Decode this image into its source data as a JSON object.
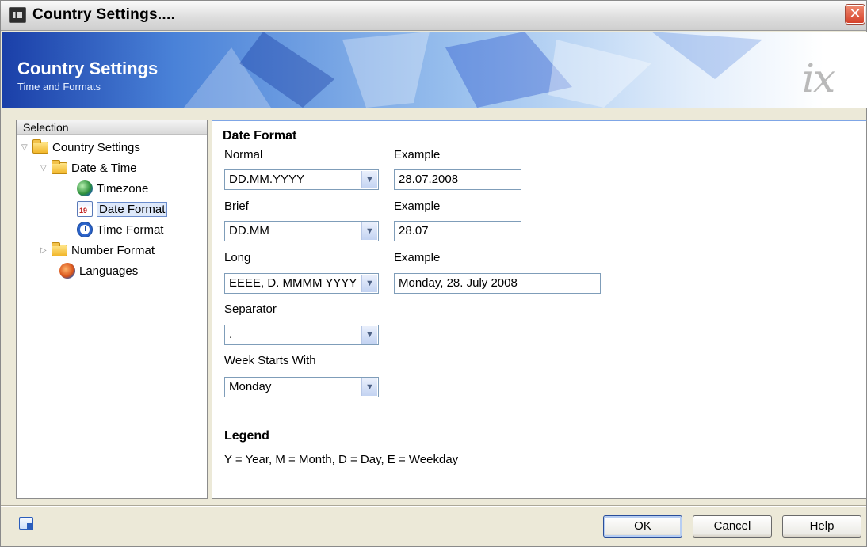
{
  "window": {
    "title": "Country Settings....",
    "close_label": "✕"
  },
  "banner": {
    "title": "Country Settings",
    "subtitle": "Time and Formats",
    "logo": "ix"
  },
  "tree": {
    "header": "Selection",
    "items": [
      {
        "label": "Country Settings",
        "icon": "folder-icon",
        "expanded": true
      },
      {
        "label": "Date & Time",
        "icon": "folder-icon",
        "expanded": true
      },
      {
        "label": "Timezone",
        "icon": "globe-icon"
      },
      {
        "label": "Date Format",
        "icon": "calendar-icon",
        "selected": true
      },
      {
        "label": "Time Format",
        "icon": "clock-icon"
      },
      {
        "label": "Number Format",
        "icon": "folder-icon",
        "expanded": false
      },
      {
        "label": "Languages",
        "icon": "languages-icon"
      }
    ]
  },
  "form": {
    "section_title": "Date Format",
    "normal": {
      "label": "Normal",
      "value": "DD.MM.YYYY",
      "example_label": "Example",
      "example": "28.07.2008"
    },
    "brief": {
      "label": "Brief",
      "value": "DD.MM",
      "example_label": "Example",
      "example": "28.07"
    },
    "long": {
      "label": "Long",
      "value": "EEEE, D. MMMM YYYY",
      "example_label": "Example",
      "example": "Monday, 28. July 2008"
    },
    "separator": {
      "label": "Separator",
      "value": "."
    },
    "week_start": {
      "label": "Week Starts With",
      "value": "Monday"
    },
    "legend_title": "Legend",
    "legend_text": "Y = Year, M = Month, D = Day, E = Weekday"
  },
  "footer": {
    "ok": "OK",
    "cancel": "Cancel",
    "help": "Help"
  },
  "colors": {
    "banner_dark": "#1a3fa8",
    "selection_border": "#6a8ccc",
    "field_border": "#7f9db9"
  }
}
